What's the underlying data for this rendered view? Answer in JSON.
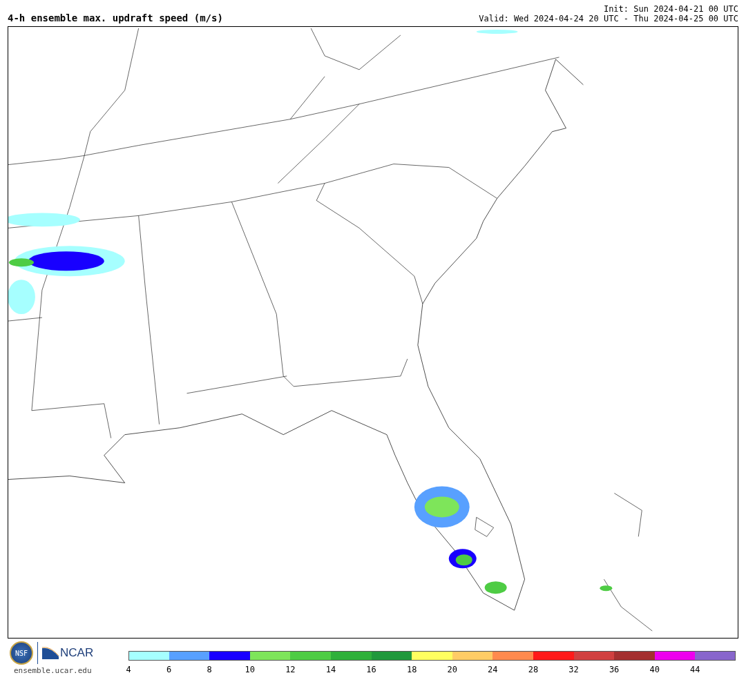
{
  "title": "4-h ensemble max. updraft speed (m/s)",
  "init": "Init: Sun 2024-04-21 00 UTC",
  "valid": "Valid: Wed 2024-04-24 20 UTC - Thu 2024-04-25 00 UTC",
  "logos": {
    "nsf": "NSF",
    "ncar": "NCAR",
    "url": "ensemble.ucar.edu"
  },
  "legend": [
    {
      "color": "#a6ffff",
      "label": "4"
    },
    {
      "color": "#58a0ff",
      "label": "6"
    },
    {
      "color": "#1800ff",
      "label": "8"
    },
    {
      "color": "#7ee55a",
      "label": "10"
    },
    {
      "color": "#4ecc44",
      "label": "12"
    },
    {
      "color": "#2fb03a",
      "label": "14"
    },
    {
      "color": "#20983c",
      "label": "16"
    },
    {
      "color": "#ffff60",
      "label": "18"
    },
    {
      "color": "#ffcc66",
      "label": "20"
    },
    {
      "color": "#ff8a4e",
      "label": "24"
    },
    {
      "color": "#ff1a1a",
      "label": "28"
    },
    {
      "color": "#d04040",
      "label": "32"
    },
    {
      "color": "#a43030",
      "label": "36"
    },
    {
      "color": "#ee00ee",
      "label": "40"
    },
    {
      "color": "#8866cc",
      "label": "44"
    }
  ]
}
